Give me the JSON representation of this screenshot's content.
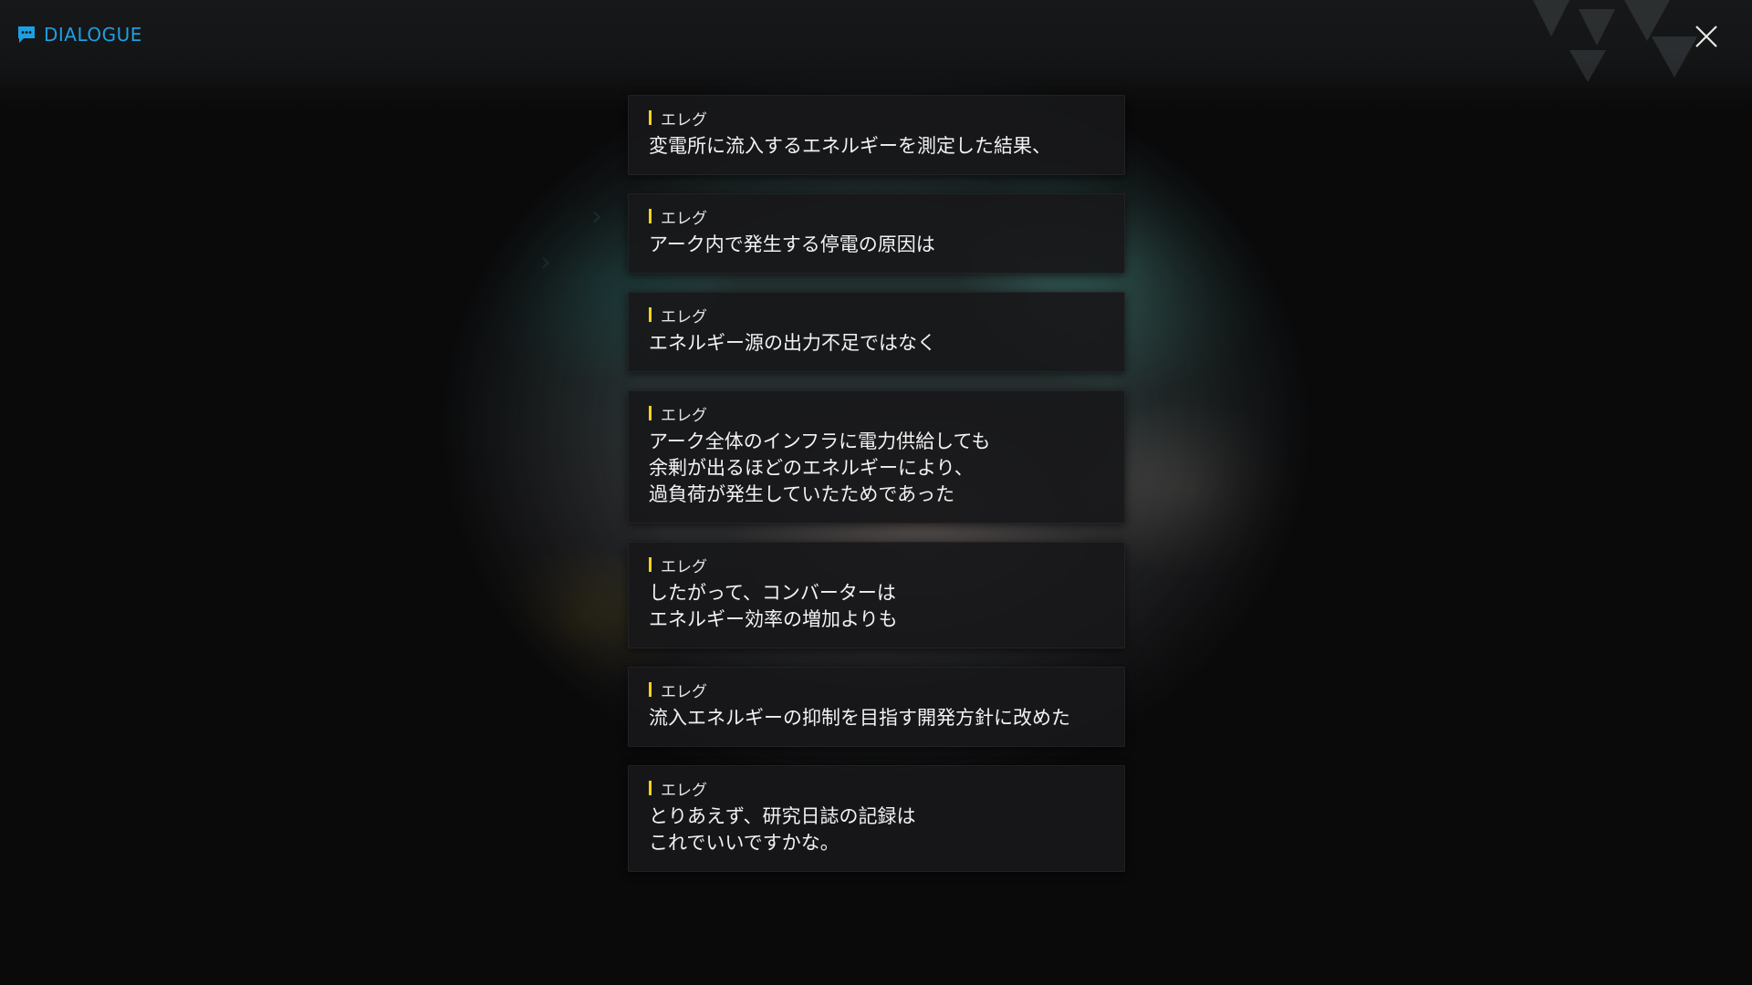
{
  "header": {
    "title": "DIALOGUE",
    "icon": "chat-bubble-icon",
    "accent": "#1e9fe2"
  },
  "close": {
    "icon": "close-icon"
  },
  "speaker_color": "#f4d21d",
  "dialogue": [
    {
      "speaker": "エレグ",
      "lines": [
        "変電所に流入するエネルギーを測定した結果、"
      ]
    },
    {
      "speaker": "エレグ",
      "lines": [
        "アーク内で発生する停電の原因は"
      ]
    },
    {
      "speaker": "エレグ",
      "lines": [
        "エネルギー源の出力不足ではなく"
      ]
    },
    {
      "speaker": "エレグ",
      "lines": [
        "アーク全体のインフラに電力供給しても",
        "余剰が出るほどのエネルギーにより、",
        "過負荷が発生していたためであった"
      ]
    },
    {
      "speaker": "エレグ",
      "lines": [
        "したがって、コンバーターは",
        "エネルギー効率の増加よりも"
      ]
    },
    {
      "speaker": "エレグ",
      "lines": [
        "流入エネルギーの抑制を目指す開発方針に改めた"
      ]
    },
    {
      "speaker": "エレグ",
      "lines": [
        "とりあえず、研究日誌の記録は",
        "これでいいですかな。"
      ]
    }
  ]
}
